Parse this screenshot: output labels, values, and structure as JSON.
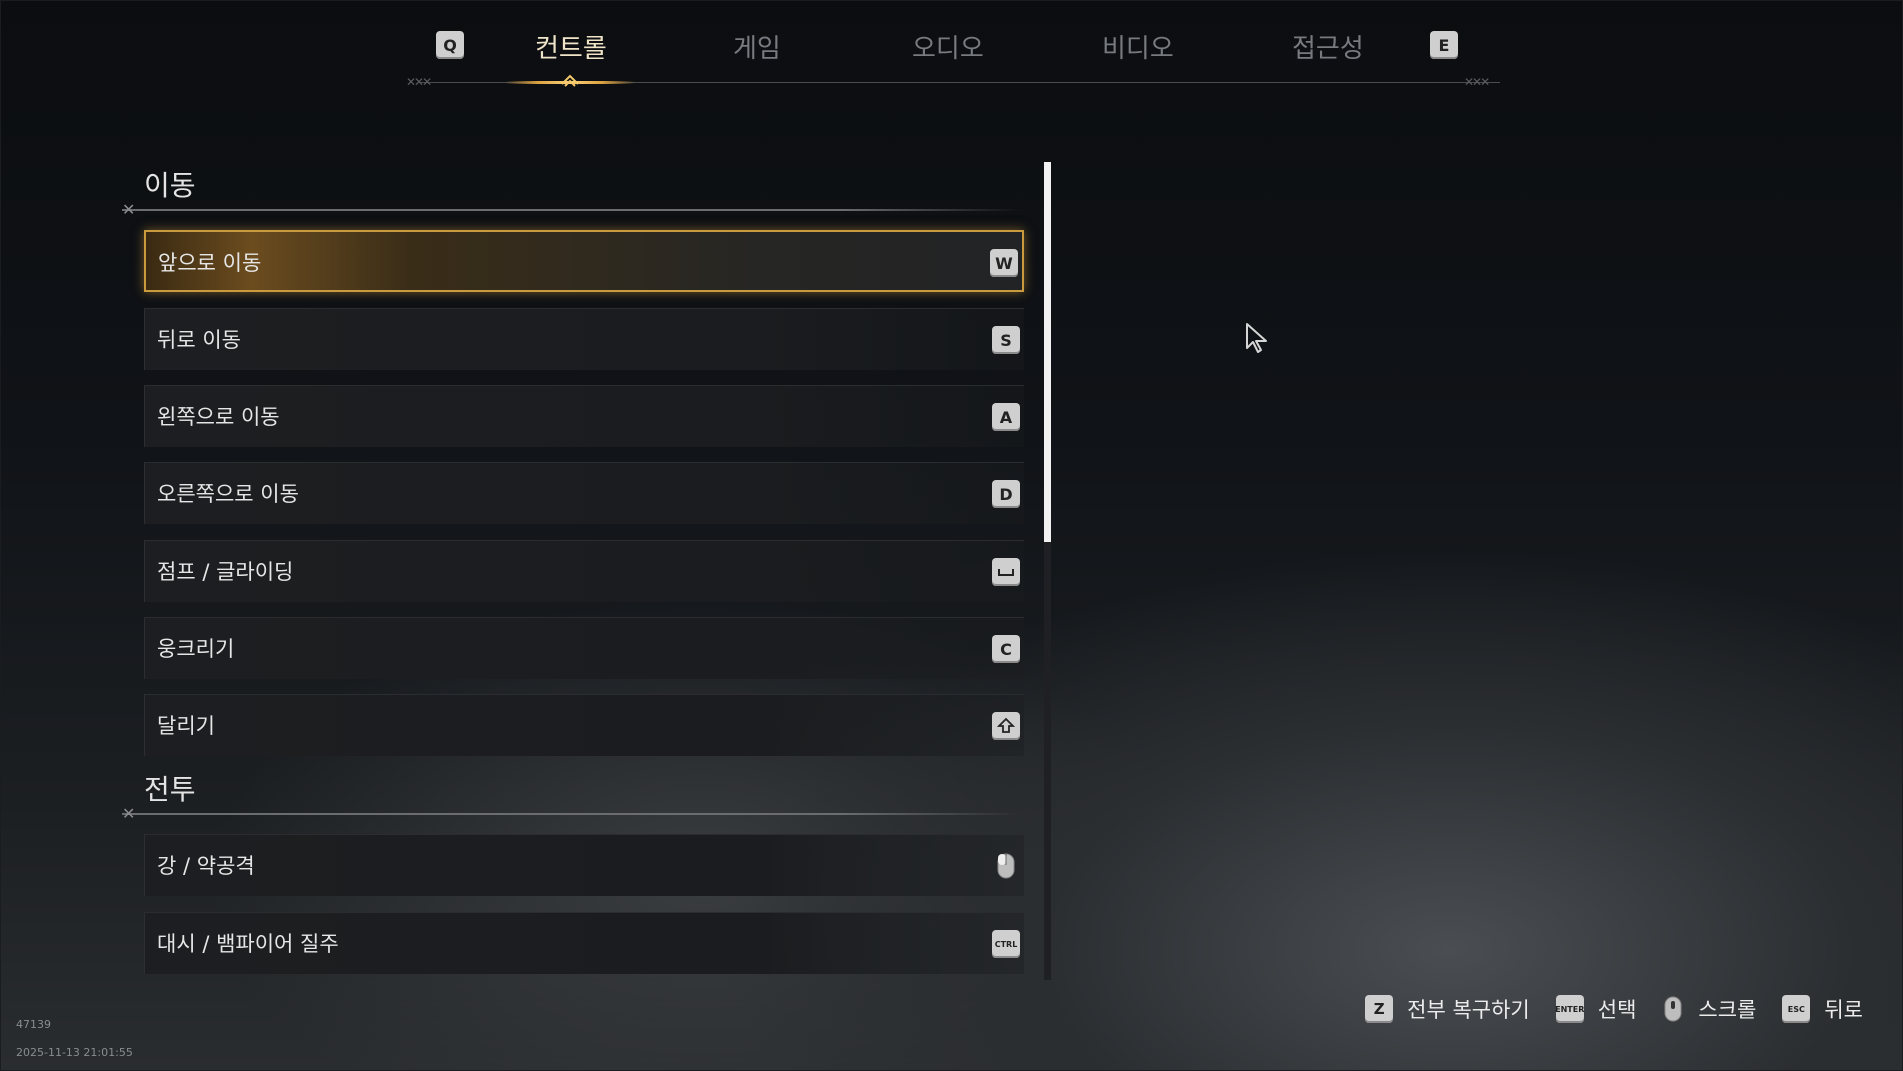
{
  "nav": {
    "prev_key": "Q",
    "next_key": "E",
    "tabs": [
      {
        "label": "컨트롤",
        "active": true
      },
      {
        "label": "게임",
        "active": false
      },
      {
        "label": "오디오",
        "active": false
      },
      {
        "label": "비디오",
        "active": false
      },
      {
        "label": "접근성",
        "active": false
      }
    ]
  },
  "sections": [
    {
      "title": "이동",
      "rows": [
        {
          "label": "앞으로 이동",
          "key": "W",
          "selected": true
        },
        {
          "label": "뒤로 이동",
          "key": "S"
        },
        {
          "label": "왼쪽으로 이동",
          "key": "A"
        },
        {
          "label": "오른쪽으로 이동",
          "key": "D"
        },
        {
          "label": "점프 / 글라이딩",
          "key": "space-icon"
        },
        {
          "label": "웅크리기",
          "key": "C"
        },
        {
          "label": "달리기",
          "key": "shift-icon"
        }
      ]
    },
    {
      "title": "전투",
      "rows": [
        {
          "label": "강 / 약공격",
          "key": "mouse-icon"
        },
        {
          "label": "대시 / 뱀파이어 질주",
          "key": "CTRL"
        }
      ]
    }
  ],
  "hints": {
    "reset": {
      "key": "Z",
      "label": "전부 복구하기"
    },
    "select": {
      "key": "ENTER",
      "label": "선택"
    },
    "scroll": {
      "key": "mouse-icon",
      "label": "스크롤"
    },
    "back": {
      "key": "ESC",
      "label": "뒤로"
    }
  },
  "meta": {
    "build": "47139",
    "timestamp": "2025-11-13 21:01:55"
  },
  "colors": {
    "accent_gold": "#c99a3e",
    "keycap": "#cfcfcf"
  }
}
